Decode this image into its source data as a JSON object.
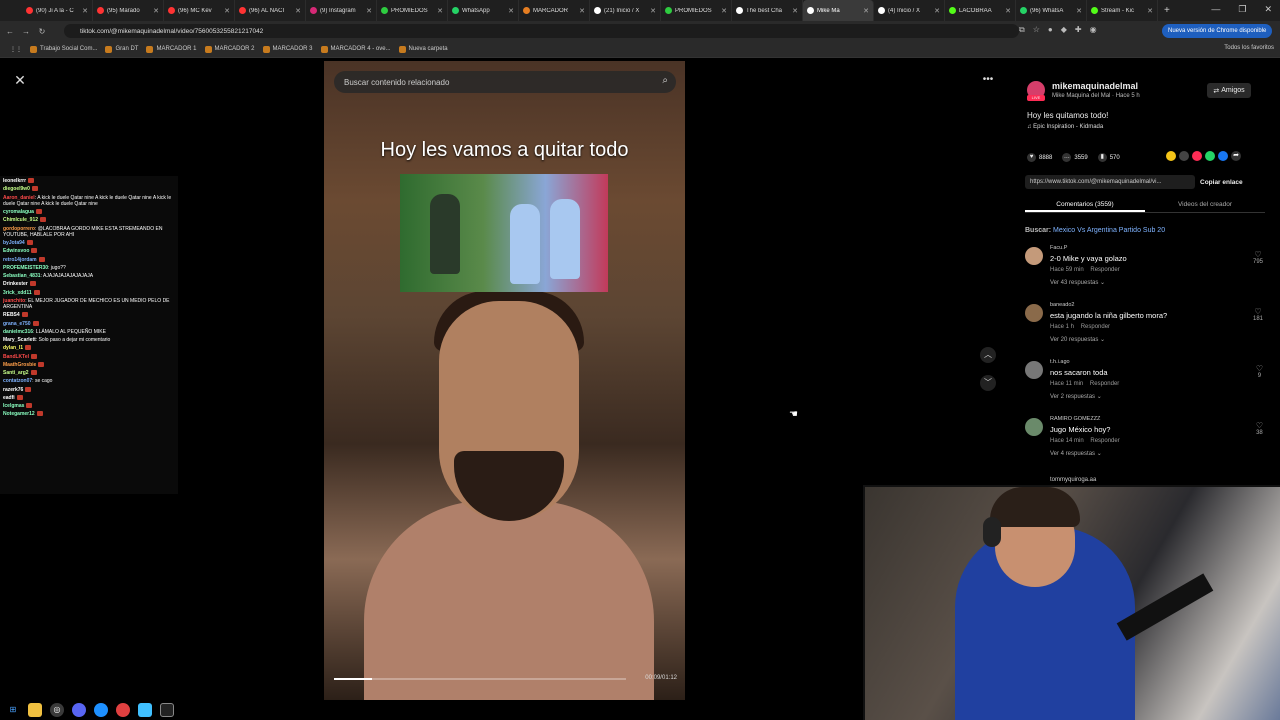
{
  "browser": {
    "tabs": [
      {
        "label": "(90) Ji A la - C",
        "color": "#ff3333"
      },
      {
        "label": "(95) Marado",
        "color": "#ff3333"
      },
      {
        "label": "(96) MC Kev",
        "color": "#ff3333"
      },
      {
        "label": "(96) AL NACI",
        "color": "#ff3333"
      },
      {
        "label": "(9) Instagram",
        "color": "#d62976"
      },
      {
        "label": "PROMIEDOS",
        "color": "#2ecc40"
      },
      {
        "label": "WhatsApp",
        "color": "#25d366"
      },
      {
        "label": "MARCADOR",
        "color": "#e67e22"
      },
      {
        "label": "(21) Inicio / X",
        "color": "#ffffff"
      },
      {
        "label": "PROMIEDOS",
        "color": "#2ecc40"
      },
      {
        "label": "The best Cha",
        "color": "#ffffff"
      },
      {
        "label": "Mike Ma",
        "color": "#ffffff"
      },
      {
        "label": "(4) Inicio / X",
        "color": "#ffffff"
      },
      {
        "label": "LACOBRAA",
        "color": "#53fc18"
      },
      {
        "label": "(96) WhatsA",
        "color": "#25d366"
      },
      {
        "label": "Stream - Kic",
        "color": "#53fc18"
      }
    ],
    "url": "tiktok.com/@mikemaquinadelmal/video/7560053255821217042",
    "update_label": "Nueva versión de Chrome disponible",
    "bookmarks": [
      "Trabajo Social Com...",
      "Gran DT",
      "MARCADOR 1",
      "MARCADOR 2",
      "MARCADOR 3",
      "MARCADOR 4 - ove...",
      "Nueva carpeta"
    ],
    "all_favorites": "Todos los favoritos"
  },
  "chat": [
    {
      "user": "leonelkrrr",
      "color": "#ffffff",
      "text": ""
    },
    {
      "user": "diegoel9w0",
      "color": "#c7ff8a",
      "text": ""
    },
    {
      "user": "Aaron_daniel",
      "color": "#ff4a4a",
      "text": ": A kick le duele Qatar nine A kick le duele Qatar nine A kick le duele Qatar nine A kick le duele Qatar nine"
    },
    {
      "user": "cyromalagua",
      "color": "#8affc1",
      "text": ""
    },
    {
      "user": "Chimlcule_912",
      "color": "#c7ff8a",
      "text": ""
    },
    {
      "user": "gordoporrero",
      "color": "#ff9f4a",
      "text": ": @LACOBRAA GORDO MIKE ESTA STREMEANDO EN YOUTUBE, HABLALE POR AHI"
    },
    {
      "user": "byJota94",
      "color": "#7fb3ff",
      "text": ""
    },
    {
      "user": "Edwinsvoo",
      "color": "#8affc1",
      "text": ""
    },
    {
      "user": "retro14jordam",
      "color": "#7fb3ff",
      "text": ""
    },
    {
      "user": "PROFEMEISTER30",
      "color": "#8affc1",
      "text": ": jugo??"
    },
    {
      "user": "Sebastian_4831",
      "color": "#8affc1",
      "text": ": AJAJAJAJAJAJAJAJA"
    },
    {
      "user": "Drinkester",
      "color": "#ffffff",
      "text": ""
    },
    {
      "user": "3rick_xdd11",
      "color": "#8affc1",
      "text": ""
    },
    {
      "user": "juanchito",
      "color": "#ff4a4a",
      "text": ": EL MEJOR JUGADOR DE MECHICO ES UN MEDIO PELO DE ARGENTINA"
    },
    {
      "user": "REBS4",
      "color": "#ffffff",
      "text": ""
    },
    {
      "user": "grana_e750",
      "color": "#7fb3ff",
      "text": ""
    },
    {
      "user": "danielmc316",
      "color": "#8affc1",
      "text": ": LLÁMALO AL PEQUEÑO MIKE"
    },
    {
      "user": "Mary_Scarlett",
      "color": "#ffffff",
      "text": ": Solo paso a dejar mi comentario"
    },
    {
      "user": "dylan_l1",
      "color": "#ffff66",
      "text": ""
    },
    {
      "user": "BandLKTel",
      "color": "#ff4a4a",
      "text": ""
    },
    {
      "user": "MaathGrosbie",
      "color": "#ff9f4a",
      "text": ""
    },
    {
      "user": "Santi_arg2",
      "color": "#c7ff8a",
      "text": ""
    },
    {
      "user": "contatzon07",
      "color": "#7fb3ff",
      "text": ": se cago"
    },
    {
      "user": "razerk76",
      "color": "#ffffff",
      "text": ""
    },
    {
      "user": "eadfi",
      "color": "#ffffff",
      "text": ""
    },
    {
      "user": "Icelgmas",
      "color": "#8affc1",
      "text": ""
    },
    {
      "user": "Notegamer12",
      "color": "#8affc1",
      "text": ""
    }
  ],
  "video": {
    "search_placeholder": "Buscar contenido relacionado",
    "caption": "Hoy les vamos a quitar todo",
    "time": "00:09/01:12",
    "progress": 0.13
  },
  "panel": {
    "username": "mikemaquinadelmal",
    "subline": "Mike Maquina del Mal · Hace 5 h",
    "live_label": "LIVE",
    "amigos_label": "Amigos",
    "description": "Hoy les quitamos todo!",
    "music": "Epic Inspiration - Kidmada",
    "likes": "8888",
    "comments": "3559",
    "saves": "570",
    "link": "https://www.tiktok.com/@mikemaquinadelmal/vi...",
    "copy_label": "Copiar enlace",
    "tab_comments": "Comentarios (3559)",
    "tab_creator": "Videos del creador",
    "related_prefix": "Buscar:",
    "related_query": "Mexico Vs Argentina Partido Sub 20",
    "reply_label": "Responder",
    "comments_list": [
      {
        "user": "Facu.P",
        "text": "2-0 Mike y vaya golazo",
        "time": "Hace 59 min",
        "replies": "Ver 43 respuestas",
        "likes": "795",
        "color": "#c49a7a"
      },
      {
        "user": "baneado2",
        "text": "esta jugando la niña gilberto mora?",
        "time": "Hace 1 h",
        "replies": "Ver 20 respuestas",
        "likes": "181",
        "color": "#8a6a4a"
      },
      {
        "user": "t.h.i.ago",
        "text": "nos sacaron toda",
        "time": "Hace 11 min",
        "replies": "Ver 2 respuestas",
        "likes": "9",
        "color": "#777777"
      },
      {
        "user": "RAMIRO GOMEZZZ",
        "text": "Jugo México hoy?",
        "time": "Hace 14 min",
        "replies": "Ver 4 respuestas",
        "likes": "38",
        "color": "#6a8a6a"
      }
    ],
    "next_user": "tommyquiroga.aa"
  }
}
